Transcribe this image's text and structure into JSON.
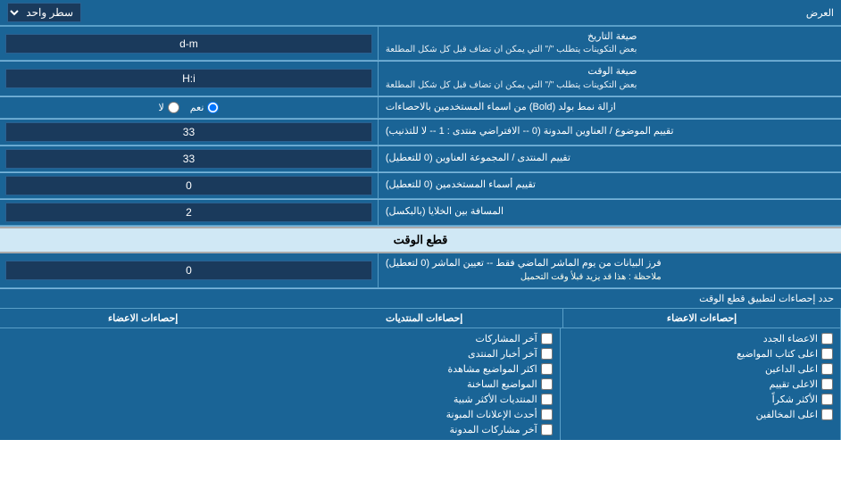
{
  "top": {
    "label": "العرض",
    "select_label": "سطر واحد"
  },
  "rows": [
    {
      "id": "date_format",
      "label": "صيغة التاريخ",
      "sublabel": "بعض التكوينات يتطلب \"/\" التي يمكن ان تضاف قبل كل شكل المطلعة",
      "input_value": "d-m",
      "type": "text"
    },
    {
      "id": "time_format",
      "label": "صيغة الوقت",
      "sublabel": "بعض التكوينات يتطلب \"/\" التي يمكن ان تضاف قبل كل شكل المطلعة",
      "input_value": "H:i",
      "type": "text"
    },
    {
      "id": "bold_remove",
      "label": "ازالة نمط بولد (Bold) من اسماء المستخدمين بالاحصاءات",
      "input_value": "",
      "type": "radio",
      "radio_options": [
        "نعم",
        "لا"
      ],
      "radio_selected": 0
    },
    {
      "id": "topic_sort",
      "label": "تقييم الموضوع / العناوين المدونة (0 -- الافتراضي منتدى : 1 -- لا للتذنيب)",
      "input_value": "33",
      "type": "text"
    },
    {
      "id": "forum_sort",
      "label": "تقييم المنتدى / المجموعة العناوين (0 للتعطيل)",
      "input_value": "33",
      "type": "text"
    },
    {
      "id": "user_sort",
      "label": "تقييم أسماء المستخدمين (0 للتعطيل)",
      "input_value": "0",
      "type": "text"
    },
    {
      "id": "cell_spacing",
      "label": "المسافة بين الخلايا (بالبكسل)",
      "input_value": "2",
      "type": "text"
    }
  ],
  "section_realtime": {
    "title": "قطع الوقت"
  },
  "realtime_row": {
    "label": "فرز البيانات من يوم الماشر الماضي فقط -- تعيين الماشر (0 لتعطيل)",
    "note": "ملاحظة : هذا قد يزيد قبلأ وقت التحميل",
    "input_value": "0"
  },
  "stats_section": {
    "apply_label": "حدد إحصاءات لتطبيق قطع الوقت",
    "col1_header": "إحصاءات الاعضاء",
    "col2_header": "إحصاءات المنتديات",
    "col3_header": ""
  },
  "checkboxes_col1": [
    {
      "label": "الاعضاء الجدد",
      "checked": false
    },
    {
      "label": "اعلى كتاب المواضيع",
      "checked": false
    },
    {
      "label": "اعلى الداعين",
      "checked": false
    },
    {
      "label": "الاعلى تقييم",
      "checked": false
    },
    {
      "label": "الأكثر شكراً",
      "checked": false
    },
    {
      "label": "اعلى المخالفين",
      "checked": false
    }
  ],
  "checkboxes_col1_header": "إحصاءات الاعضاء",
  "checkboxes_col2": [
    {
      "label": "آخر المشاركات",
      "checked": false
    },
    {
      "label": "آخر أخبار المنتدى",
      "checked": false
    },
    {
      "label": "اكثر المواضيع مشاهدة",
      "checked": false
    },
    {
      "label": "المواضيع الساخنة",
      "checked": false
    },
    {
      "label": "المنتديات الأكثر شبية",
      "checked": false
    },
    {
      "label": "أحدث الإعلانات المبونة",
      "checked": false
    },
    {
      "label": "آخر مشاركات المدونة",
      "checked": false
    }
  ],
  "checkboxes_col2_header": "إحصاءات المنتديات",
  "checkboxes_col3": [],
  "checkboxes_col3_header": "إحصاءات الاعضاء"
}
